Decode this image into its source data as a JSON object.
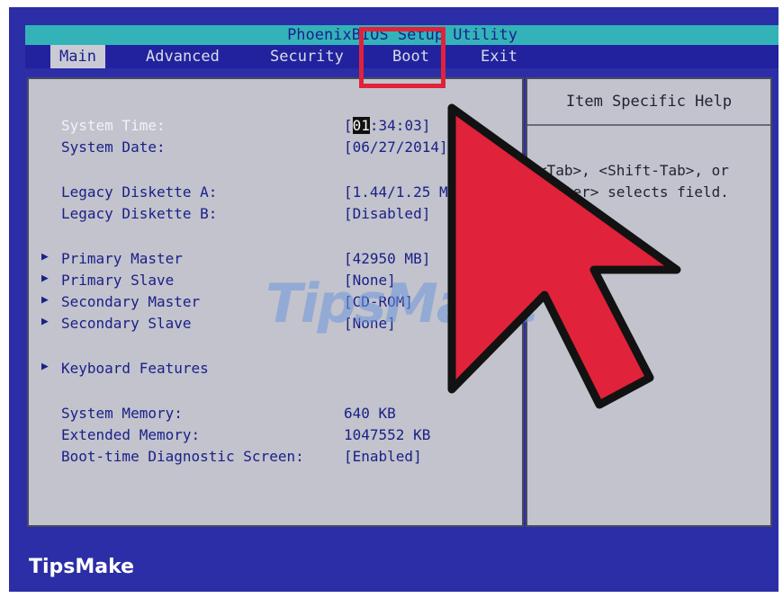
{
  "title_bar": {
    "text": "PhoenixBIOS Setup Utility"
  },
  "menu": {
    "items": [
      {
        "label": "Main"
      },
      {
        "label": "Advanced"
      },
      {
        "label": "Security"
      },
      {
        "label": "Boot"
      },
      {
        "label": "Exit"
      }
    ],
    "active": "Main"
  },
  "settings": {
    "system_time": {
      "label": "System Time:",
      "value_hour": "01",
      "value_rest": ":34:03]"
    },
    "system_date": {
      "label": "System Date:",
      "value": "[06/27/2014]"
    },
    "legacy_a": {
      "label": "Legacy Diskette A:",
      "value": "[1.44/1.25 MB 3½\"]"
    },
    "legacy_b": {
      "label": "Legacy Diskette B:",
      "value": "[Disabled]"
    },
    "primary_master": {
      "label": "Primary Master",
      "value": "[42950 MB]"
    },
    "primary_slave": {
      "label": "Primary Slave",
      "value": "[None]"
    },
    "secondary_master": {
      "label": "Secondary Master",
      "value": "[CD-ROM]"
    },
    "secondary_slave": {
      "label": "Secondary Slave",
      "value": "[None]"
    },
    "keyboard_features": {
      "label": "Keyboard Features"
    },
    "system_memory": {
      "label": "System Memory:",
      "value": "640 KB"
    },
    "extended_memory": {
      "label": "Extended Memory:",
      "value": "1047552 KB"
    },
    "boot_diag": {
      "label": "Boot-time Diagnostic Screen:",
      "value": "[Enabled]"
    }
  },
  "help": {
    "title": "Item Specific Help",
    "text": "<Tab>, <Shift-Tab>, or <Enter> selects field."
  },
  "watermark": {
    "text": "TipsMake"
  },
  "brand": {
    "text": "TipsMake"
  },
  "colors": {
    "bios_blue": "#2b2ea6",
    "panel_gray": "#c2c3cc",
    "title_cyan": "#33b3b8",
    "annotation_red": "#e0223a"
  },
  "icons": {
    "submenu": "triangle-right-icon",
    "pointer": "big-red-arrow-icon"
  }
}
